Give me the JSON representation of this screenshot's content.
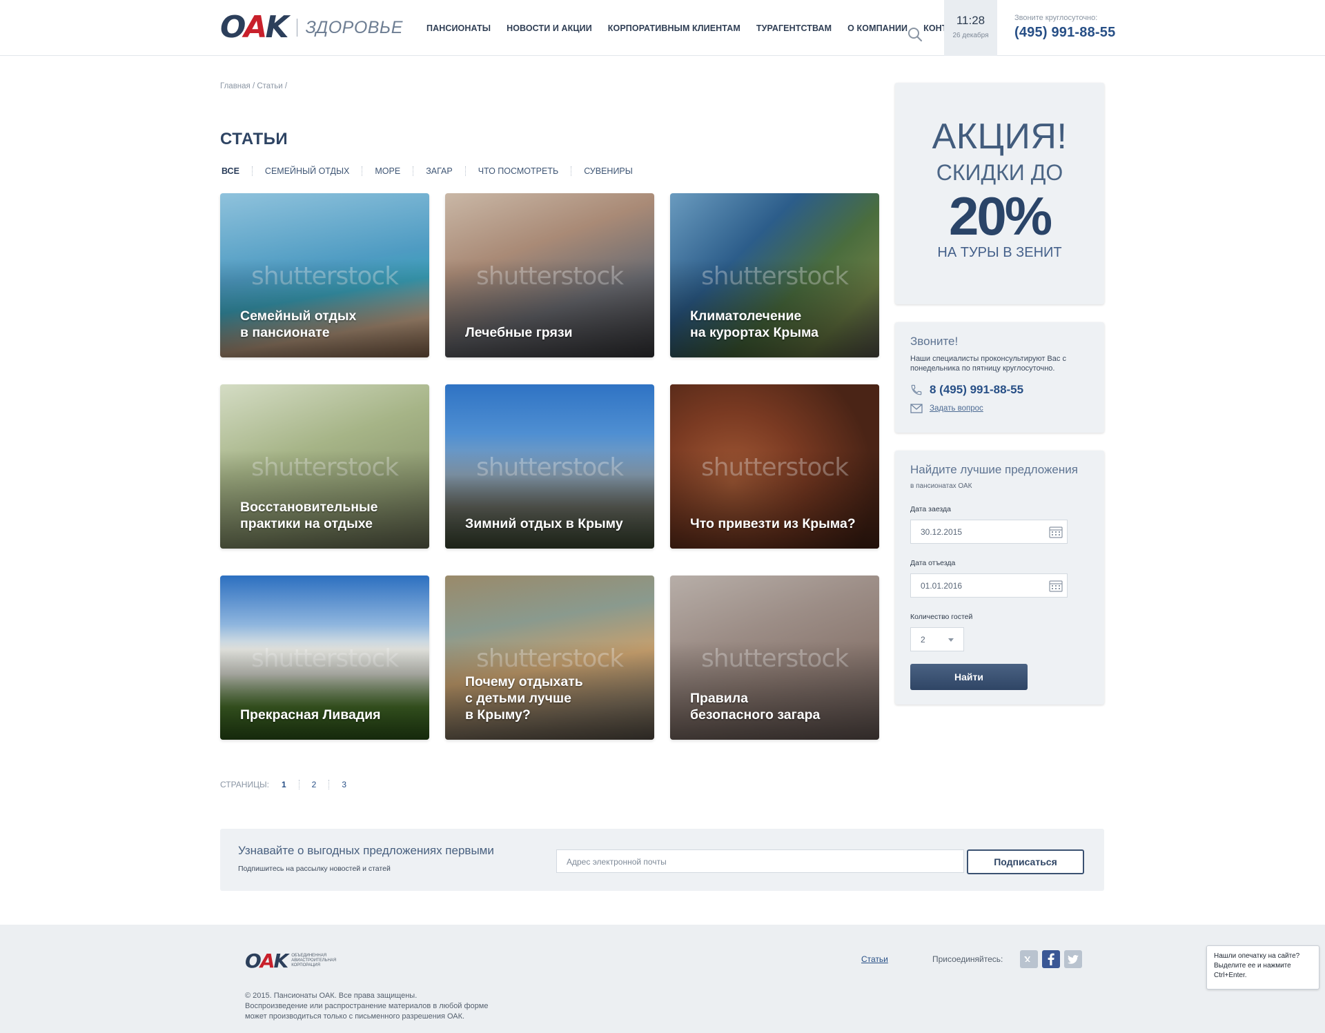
{
  "header": {
    "logo_text": "OAK",
    "logo_subtitle": "ЗДОРОВЬЕ",
    "nav": [
      "ПАНСИОНАТЫ",
      "НОВОСТИ И АКЦИИ",
      "КОРПОРАТИВНЫМ КЛИЕНТАМ",
      "ТУРАГЕНТСТВАМ",
      "О КОМПАНИИ",
      "КОНТАКТЫ"
    ],
    "time": "11:28",
    "date": "26 декабря",
    "phone_label": "Звоните круглосуточно:",
    "phone": "(495) 991-88-55"
  },
  "breadcrumb": "Главная / Статьи /",
  "page_title": "СТАТЬИ",
  "filters": [
    "ВСЕ",
    "СЕМЕЙНЫЙ ОТДЫХ",
    "МОРЕ",
    "ЗАГАР",
    "ЧТО ПОСМОТРЕТЬ",
    "СУВЕНИРЫ"
  ],
  "watermark": "shutterstock",
  "cards": [
    {
      "title": "Семейный отдых\nв пансионате"
    },
    {
      "title": "Лечебные грязи"
    },
    {
      "title": "Климатолечение\nна курортах Крыма"
    },
    {
      "title": "Восстановительные\nпрактики на отдыхе"
    },
    {
      "title": "Зимний отдых в Крыму"
    },
    {
      "title": "Что привезти из Крыма?"
    },
    {
      "title": "Прекрасная Ливадия"
    },
    {
      "title": "Почему отдыхать\nс детьми лучше\nв Крыму?"
    },
    {
      "title": "Правила\nбезопасного загара"
    }
  ],
  "pager": {
    "label": "СТРАНИЦЫ:",
    "pages": [
      "1",
      "2",
      "3"
    ]
  },
  "promo": {
    "line1": "АКЦИЯ!",
    "line2": "СКИДКИ ДО",
    "line3": "20%",
    "line4": "НА ТУРЫ В ЗЕНИТ"
  },
  "call": {
    "title": "Звоните!",
    "text": "Наши специалисты проконсультируют Вас с понедельника по пятницу круглосуточно.",
    "phone": "8 (495) 991-88-55",
    "ask": "Задать вопрос"
  },
  "finder": {
    "title": "Найдите лучшие предложения",
    "subtitle": "в пансионатах ОАК",
    "checkin_label": "Дата заезда",
    "checkin_value": "30.12.2015",
    "checkout_label": "Дата отъезда",
    "checkout_value": "01.01.2016",
    "guests_label": "Количество гостей",
    "guests_value": "2",
    "button": "Найти"
  },
  "subscribe": {
    "title": "Узнавайте о выгодных предложениях первыми",
    "text": "Подпишитесь на рассылку новостей и статей",
    "placeholder": "Адрес электронной почты",
    "button": "Подписаться"
  },
  "footer": {
    "logo_text": "OAK",
    "logo_corp": "ОБЪЕДИНЕННАЯ АВИАСТРОИТЕЛЬНАЯ КОРПОРАЦИЯ",
    "copyright_line1": "© 2015. Пансионаты ОАК. Все права защищены.",
    "copyright_line2": "Воспроизведение или распространение материалов в любой форме",
    "copyright_line3": "может производиться только с письменного разрешения ОАК.",
    "link": "Статьи",
    "join": "Присоединяйтесь:",
    "social": [
      "vk-icon",
      "facebook-icon",
      "twitter-icon"
    ]
  },
  "typo": {
    "line1": "Нашли опечатку на сайте?",
    "line2": "Выделите ее и нажмите",
    "line3": "Ctrl+Enter."
  }
}
